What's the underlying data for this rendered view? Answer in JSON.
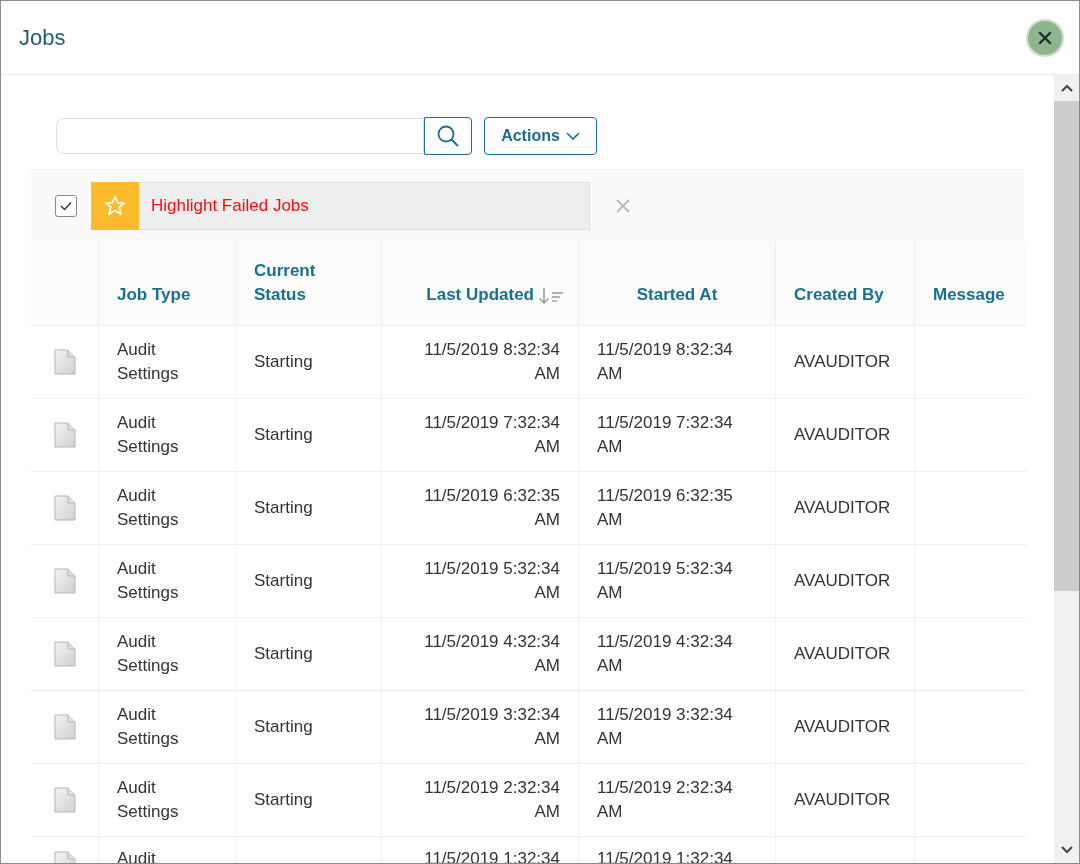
{
  "window": {
    "title": "Jobs"
  },
  "toolbar": {
    "actions_label": "Actions"
  },
  "filter": {
    "checked": true,
    "label": "Highlight Failed Jobs"
  },
  "table": {
    "columns": [
      {
        "sorted": false
      },
      {
        "label": "Job Type",
        "sorted": false
      },
      {
        "label": "Current Status",
        "sorted": false
      },
      {
        "label": "Last Updated",
        "sorted": true
      },
      {
        "label": "Started At",
        "sorted": false
      },
      {
        "label": "Created By",
        "sorted": false
      },
      {
        "label": "Message",
        "sorted": false
      }
    ],
    "rows": [
      {
        "job_type": "Audit Settings",
        "status": "Starting",
        "last_updated": "11/5/2019 8:32:34 AM",
        "started_at": "11/5/2019 8:32:34 AM",
        "created_by": "AVAUDITOR"
      },
      {
        "job_type": "Audit Settings",
        "status": "Starting",
        "last_updated": "11/5/2019 7:32:34 AM",
        "started_at": "11/5/2019 7:32:34 AM",
        "created_by": "AVAUDITOR"
      },
      {
        "job_type": "Audit Settings",
        "status": "Starting",
        "last_updated": "11/5/2019 6:32:35 AM",
        "started_at": "11/5/2019 6:32:35 AM",
        "created_by": "AVAUDITOR"
      },
      {
        "job_type": "Audit Settings",
        "status": "Starting",
        "last_updated": "11/5/2019 5:32:34 AM",
        "started_at": "11/5/2019 5:32:34 AM",
        "created_by": "AVAUDITOR"
      },
      {
        "job_type": "Audit Settings",
        "status": "Starting",
        "last_updated": "11/5/2019 4:32:34 AM",
        "started_at": "11/5/2019 4:32:34 AM",
        "created_by": "AVAUDITOR"
      },
      {
        "job_type": "Audit Settings",
        "status": "Starting",
        "last_updated": "11/5/2019 3:32:34 AM",
        "started_at": "11/5/2019 3:32:34 AM",
        "created_by": "AVAUDITOR"
      },
      {
        "job_type": "Audit Settings",
        "status": "Starting",
        "last_updated": "11/5/2019 2:32:34 AM",
        "started_at": "11/5/2019 2:32:34 AM",
        "created_by": "AVAUDITOR"
      },
      {
        "job_type": "Audit",
        "last_updated": "11/5/2019 1:32:34",
        "started_at": "11/5/2019 1:32:34"
      }
    ]
  }
}
